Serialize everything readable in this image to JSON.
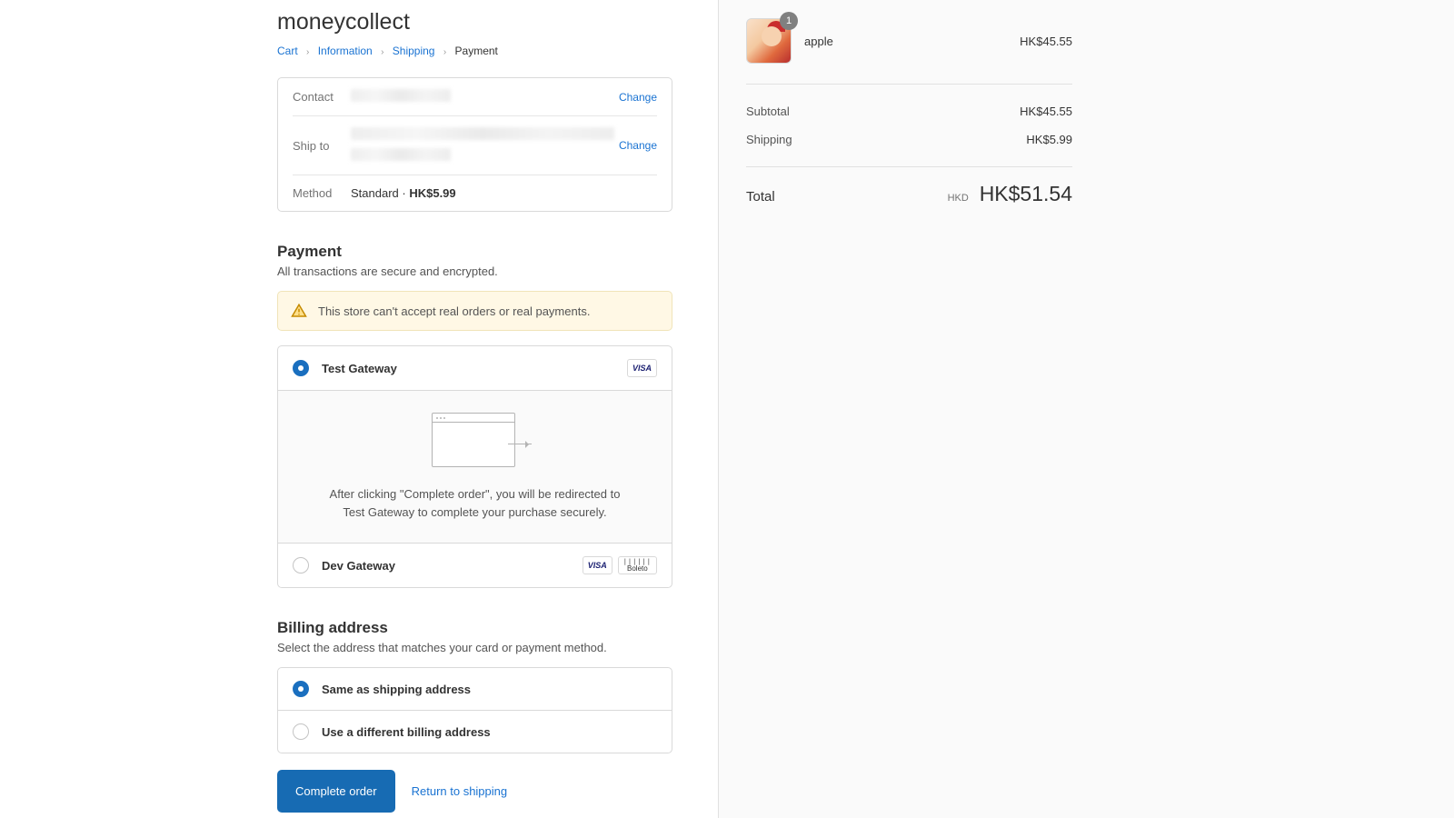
{
  "store": {
    "title": "moneycollect"
  },
  "breadcrumb": {
    "cart": "Cart",
    "information": "Information",
    "shipping": "Shipping",
    "payment": "Payment"
  },
  "review": {
    "contact_label": "Contact",
    "contact_value": "",
    "ship_label": "Ship to",
    "ship_value": "",
    "method_label": "Method",
    "method_value_name": "Standard",
    "method_value_price": "HK$5.99",
    "change": "Change"
  },
  "payment": {
    "title": "Payment",
    "subtitle": "All transactions are secure and encrypted.",
    "notice": "This store can't accept real orders or real payments.",
    "options": [
      {
        "label": "Test Gateway",
        "selected": true,
        "brands": [
          "VISA"
        ]
      },
      {
        "label": "Dev Gateway",
        "selected": false,
        "brands": [
          "VISA",
          "Boleto"
        ]
      }
    ],
    "redirect_text": "After clicking \"Complete order\", you will be redirected to Test Gateway to complete your purchase securely."
  },
  "billing": {
    "title": "Billing address",
    "subtitle": "Select the address that matches your card or payment method.",
    "options": [
      {
        "label": "Same as shipping address",
        "selected": true
      },
      {
        "label": "Use a different billing address",
        "selected": false
      }
    ]
  },
  "actions": {
    "complete": "Complete order",
    "return": "Return to shipping"
  },
  "cart": {
    "items": [
      {
        "name": "apple",
        "qty": "1",
        "price": "HK$45.55"
      }
    ],
    "subtotal_label": "Subtotal",
    "subtotal_value": "HK$45.55",
    "shipping_label": "Shipping",
    "shipping_value": "HK$5.99",
    "total_label": "Total",
    "total_currency": "HKD",
    "total_value": "HK$51.54"
  }
}
